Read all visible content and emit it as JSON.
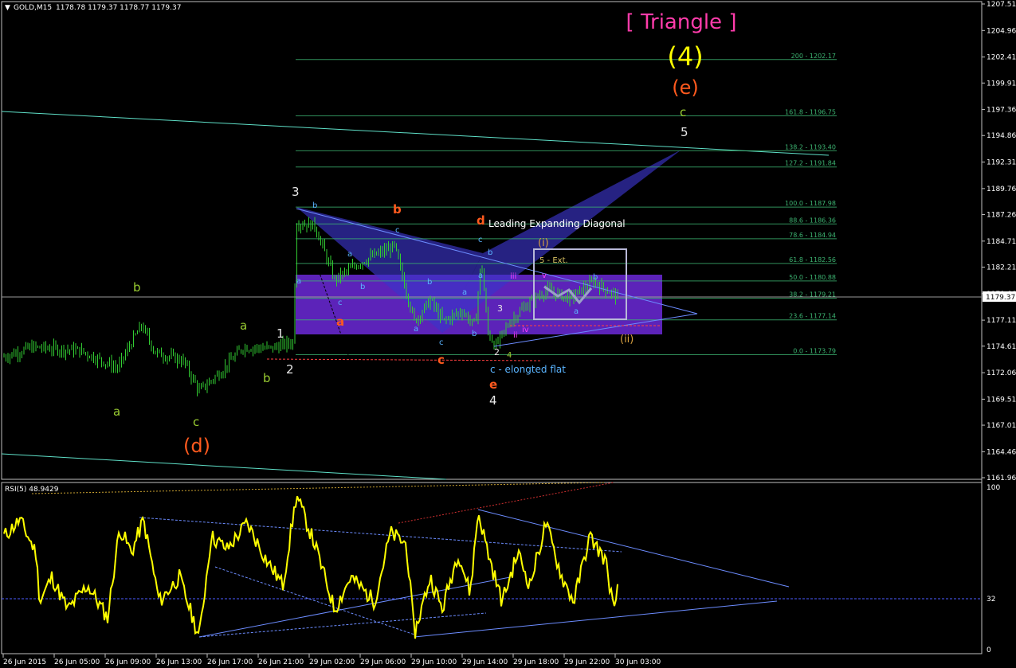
{
  "header": {
    "symbol": "GOLD,M15",
    "ohlc": "1178.78 1179.37 1178.77 1179.37"
  },
  "title": {
    "triangle": "[ Triangle ]",
    "wave4": "(4)",
    "wave_e": "(e)"
  },
  "price_axis": {
    "ticks": [
      "1207.51",
      "1204.96",
      "1202.41",
      "1199.91",
      "1197.36",
      "1194.86",
      "1192.31",
      "1189.76",
      "1187.26",
      "1184.71",
      "1182.21",
      "1179.66",
      "1177.11",
      "1174.61",
      "1172.06",
      "1169.51",
      "1167.01",
      "1164.46",
      "1161.96"
    ],
    "current_price": "1179.37"
  },
  "rsi": {
    "label": "RSI(5) 48.9429",
    "ticks": [
      "100",
      "32",
      "0"
    ]
  },
  "time_axis": {
    "ticks": [
      "26 Jun 2015",
      "26 Jun 05:00",
      "26 Jun 09:00",
      "26 Jun 13:00",
      "26 Jun 17:00",
      "26 Jun 21:00",
      "29 Jun 02:00",
      "29 Jun 06:00",
      "29 Jun 10:00",
      "29 Jun 14:00",
      "29 Jun 18:00",
      "29 Jun 22:00",
      "30 Jun 03:00"
    ]
  },
  "fib_levels": [
    "200 - 1202.17",
    "161.8 - 1196.75",
    "138.2 - 1193.40",
    "127.2 - 1191.84",
    "100.0 - 1187.98",
    "88.6 - 1186.36",
    "78.6 - 1184.94",
    "61.8 - 1182.56",
    "50.0 - 1180.88",
    "38.2 - 1179.21",
    "23.6 - 1177.14",
    "0.0 - 1173.79"
  ],
  "annotations": {
    "leading_diagonal": "Leading Expanding Diagonal",
    "five_ext": "5 - Ext.",
    "elongated_flat": "c - elongted flat",
    "wave_i": "(i)",
    "wave_ii": "(ii)",
    "wave_d": "(d)",
    "labels": [
      "a",
      "b",
      "c",
      "1",
      "2",
      "3",
      "4",
      "5",
      "a",
      "b",
      "c",
      "d",
      "e",
      "i",
      "ii",
      "iii",
      "iv",
      "v"
    ]
  },
  "colors": {
    "candle": "#32cd32",
    "rsi_line": "#ffff00",
    "fib": "#3cb371",
    "zone": "#7b2ff7",
    "harmonic": "#3a34c8",
    "title": "#ff3cab",
    "wave_orange": "#ff5a1e",
    "wave_green": "#9acd32"
  },
  "chart_data": {
    "type": "candlestick",
    "symbol": "GOLD",
    "timeframe": "M15",
    "ylim": [
      1161.96,
      1207.51
    ],
    "close_series_approx": [
      {
        "t": "26 Jun 2015 00:00",
        "price": 1173.6
      },
      {
        "t": "26 Jun 05:00",
        "price": 1174.5
      },
      {
        "t": "26 Jun 09:00",
        "price": 1176.5
      },
      {
        "t": "26 Jun 12:00",
        "price": 1174.0
      },
      {
        "t": "26 Jun 14:00",
        "price": 1170.5
      },
      {
        "t": "26 Jun 17:00",
        "price": 1173.0
      },
      {
        "t": "26 Jun 21:00",
        "price": 1174.8
      },
      {
        "t": "29 Jun 00:00",
        "price": 1186.5
      },
      {
        "t": "29 Jun 02:00",
        "price": 1181.0
      },
      {
        "t": "29 Jun 06:00",
        "price": 1183.5
      },
      {
        "t": "29 Jun 10:00",
        "price": 1177.0
      },
      {
        "t": "29 Jun 12:00",
        "price": 1182.0
      },
      {
        "t": "29 Jun 14:00",
        "price": 1175.0
      },
      {
        "t": "29 Jun 18:00",
        "price": 1180.0
      },
      {
        "t": "29 Jun 22:00",
        "price": 1180.5
      },
      {
        "t": "30 Jun 00:00",
        "price": 1179.37
      }
    ],
    "rsi_period": 5,
    "rsi_last": 48.9429
  }
}
